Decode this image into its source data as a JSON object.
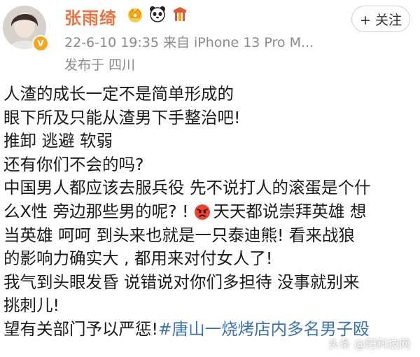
{
  "post": {
    "author": {
      "name": "张雨绮",
      "verified_badge": "V"
    },
    "badges": [
      "crown-icon",
      "panda-icon",
      "gate-icon"
    ],
    "meta_line": "22-6-10 19:35  来自 iPhone 13 Pro M...",
    "location": "发布于 四川",
    "follow_label": "+ 关注",
    "lines": [
      "人渣的成长一定不是简单形成的",
      "眼下所及只能从渣男下手整治吧!",
      "推卸 逃避 软弱",
      "还有你们不会的吗?",
      "中国男人都应该去服兵役 先不说打人的滚蛋是个什",
      "么X性 旁边那些男的呢? !",
      "天天都说崇拜英雄 想",
      "当英雄 呵呵 到头来也就是一只泰迪熊! 看来战狼",
      "的影响力确实大 , 都用来对付女人了!",
      "我气到头眼发昏 说错说对你们多担待 没事就别来",
      "挑刺儿!",
      "望有关部门予以严惩!",
      "#唐山一烧烤店内多名男子殴"
    ],
    "emoji_name": "angry-face-icon"
  },
  "watermark": "头条 @阳科技网"
}
